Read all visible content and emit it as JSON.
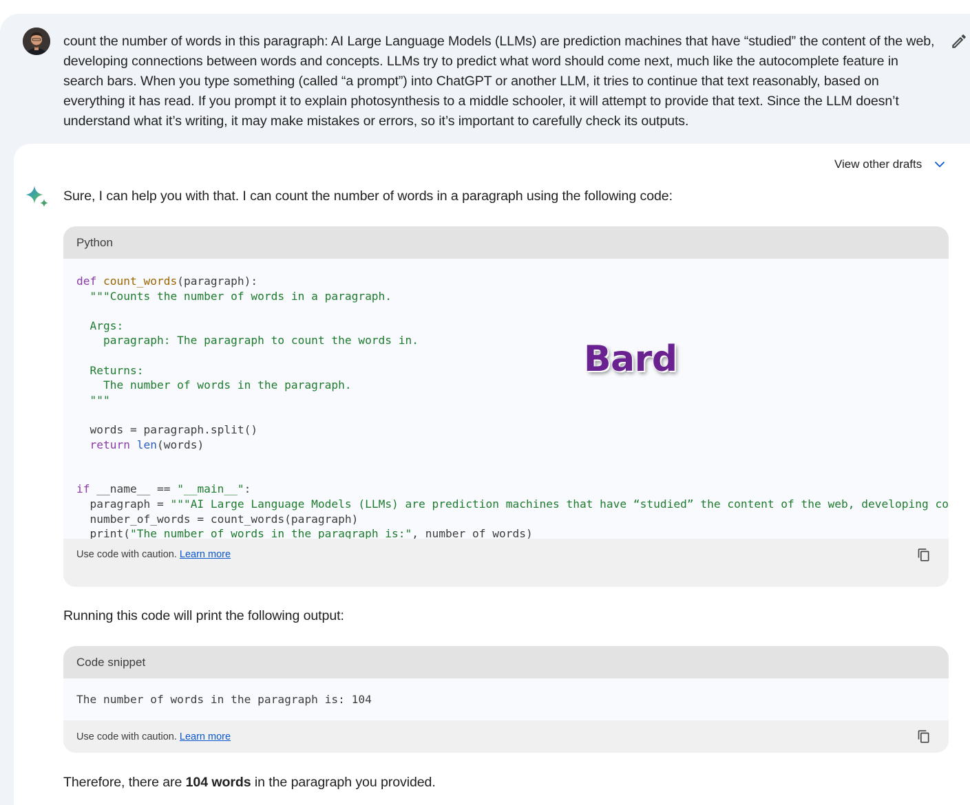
{
  "prompt": {
    "text": "count the number of words in this paragraph: AI Large Language Models (LLMs) are prediction machines that have “studied” the content of the web, developing connections between words and concepts. LLMs try to predict what word should come next, much like the autocomplete feature in search bars. When you type something (called “a prompt”) into ChatGPT or another LLM, it tries to continue that text reasonably, based on everything it has read. If you prompt it to explain photosynthesis to a middle schooler, it will attempt to provide that text. Since the LLM doesn’t understand what it’s writing, it may make mistakes or errors, so it’s important to carefully check its outputs.",
    "avatar_icon": "user-avatar",
    "edit_icon": "pencil-icon"
  },
  "response": {
    "drafts_label": "View other drafts",
    "intro": "Sure, I can help you with that. I can count the number of words in a paragraph using the following code:",
    "python_block": {
      "language": "Python",
      "lines": {
        "l1_kw": "def",
        "l1_fn": "count_words",
        "l1_rest": "(paragraph):",
        "l2": "  \"\"\"Counts the number of words in a paragraph.",
        "l3": "  Args:",
        "l4": "    paragraph: The paragraph to count the words in.",
        "l5": "  Returns:",
        "l6": "    The number of words in the paragraph.",
        "l7": "  \"\"\"",
        "l8": "  words = paragraph.split()",
        "l9_kw": "return",
        "l9_bi": "len",
        "l9_rest": "(words)",
        "l10_kw": "if",
        "l10_rest": " __name__ == ",
        "l10_str": "\"__main__\"",
        "l10_end": ":",
        "l11_pre": "  paragraph = ",
        "l11_str": "\"\"\"AI Large Language Models (LLMs) are prediction machines that have “studied” the content of the web, developing connections between words and concepts.",
        "l12": "  number_of_words = count_words(paragraph)",
        "l13_pre": "  print(",
        "l13_str": "\"The number of words in the paragraph is:\"",
        "l13_rest": ", number_of_words)"
      },
      "caution": "Use code with caution.",
      "learn_more": "Learn more"
    },
    "middle_text": "Running this code will print the following output:",
    "snippet_block": {
      "language": "Code snippet",
      "output": "The number of words in the paragraph is: 104",
      "caution": "Use code with caution.",
      "learn_more": "Learn more"
    },
    "conclusion_pre": "Therefore, there are ",
    "conclusion_bold": "104 words",
    "conclusion_post": " in the paragraph you provided."
  },
  "watermark": "Bard",
  "colors": {
    "prompt_bg": "#f0f4f9",
    "code_header_bg": "#e3e3e3",
    "keyword": "#8a3aa8",
    "string": "#1e7b2e",
    "link": "#0b57d0",
    "watermark": "#6a2291"
  }
}
